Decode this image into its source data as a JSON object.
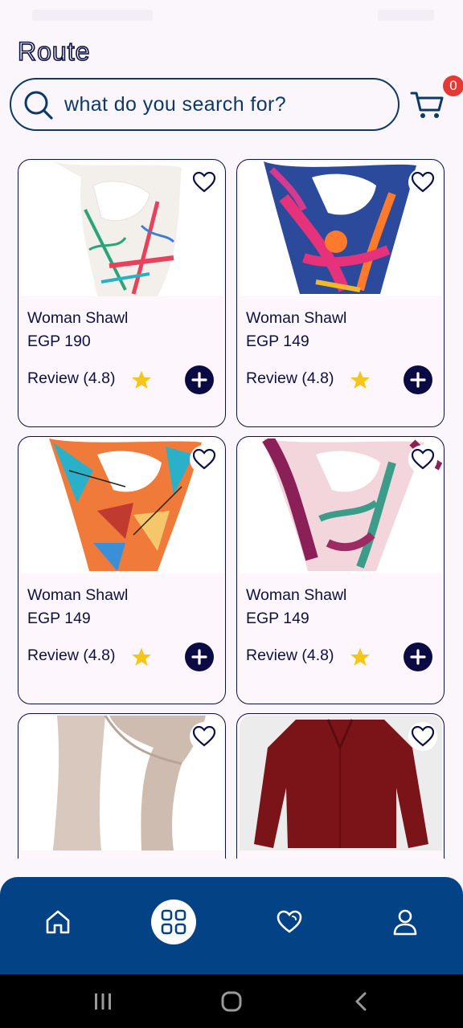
{
  "app": {
    "logo_text": "Route"
  },
  "search": {
    "placeholder": "what do you search for?",
    "value": ""
  },
  "cart": {
    "count": "0"
  },
  "products": [
    {
      "name": "Woman Shawl",
      "price": "EGP 190",
      "review": "Review (4.8)",
      "image": "floral-white-scarf"
    },
    {
      "name": "Woman Shawl",
      "price": "EGP 149",
      "review": "Review (4.8)",
      "image": "pink-blue-scarf"
    },
    {
      "name": "Woman Shawl",
      "price": "EGP 149",
      "review": "Review (4.8)",
      "image": "geometric-orange-scarf"
    },
    {
      "name": "Woman Shawl",
      "price": "EGP 149",
      "review": "Review (4.8)",
      "image": "magenta-leaf-scarf"
    },
    {
      "name": "",
      "price": "",
      "review": "",
      "image": "beige-scarf"
    },
    {
      "name": "",
      "price": "",
      "review": "",
      "image": "maroon-blouse"
    }
  ],
  "bottom_nav": {
    "items": [
      {
        "icon": "home-icon",
        "active": false
      },
      {
        "icon": "categories-icon",
        "active": true
      },
      {
        "icon": "heart-icon",
        "active": false
      },
      {
        "icon": "profile-icon",
        "active": false
      }
    ]
  },
  "colors": {
    "primary": "#044286",
    "accent_dark": "#0b0b44",
    "star": "#f5c518",
    "badge": "#e53935",
    "background": "#fbf5fc"
  }
}
